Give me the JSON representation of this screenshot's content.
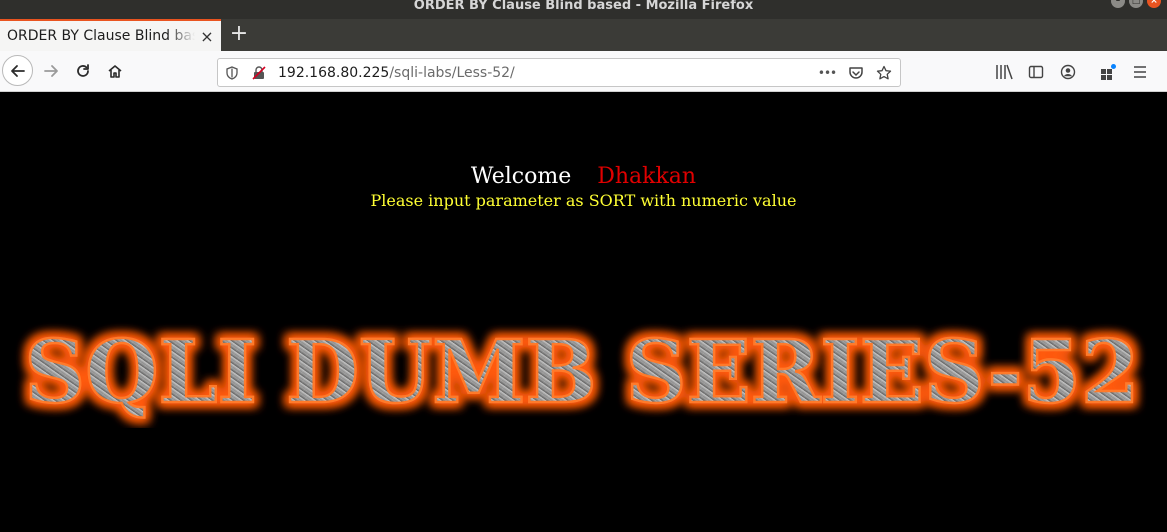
{
  "window": {
    "title": "ORDER BY Clause Blind based - Mozilla Firefox",
    "controls": [
      "–",
      "□",
      "×"
    ]
  },
  "tab": {
    "label": "ORDER BY Clause Blind based",
    "close": "×",
    "new_tab": "+"
  },
  "navbar": {
    "url_host": "192.168.80.225",
    "url_path": "/sqli-labs/Less-52/",
    "page_actions": "•••"
  },
  "page": {
    "welcome": "Welcome",
    "name": "Dhakkan",
    "instruction": "Please input parameter as SORT with numeric value",
    "banner_text": "SQLI DUMB SERIES-52"
  },
  "colors": {
    "accent": "#e95420",
    "welcome": "#ffffff",
    "name": "#e00000",
    "instruction": "#ffff33",
    "banner_glow": "#ff5a0a"
  }
}
